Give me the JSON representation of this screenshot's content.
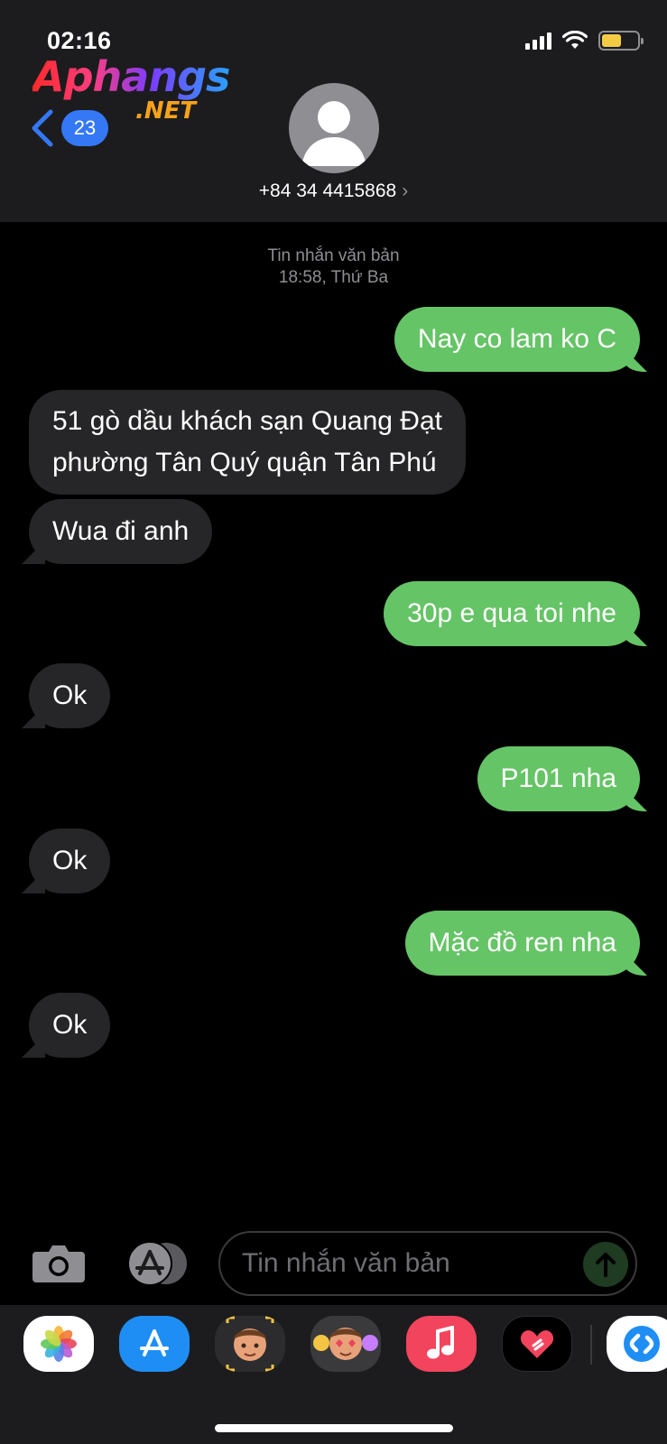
{
  "status_bar": {
    "time": "02:16",
    "battery_level": 0.55,
    "signal_bars": 4
  },
  "watermark": {
    "main": "Aphangs",
    "sub": ".NET"
  },
  "nav": {
    "back_count": "23"
  },
  "contact": {
    "phone": "+84 34 4415868",
    "chevron": "›",
    "avatar_icon": "person-silhouette-icon"
  },
  "thread_meta": {
    "type": "Tin nhắn văn bản",
    "timestamp": "18:58, Thứ Ba"
  },
  "messages": [
    {
      "direction": "outgoing",
      "text": "Nay co lam ko C"
    },
    {
      "direction": "incoming",
      "text": "51 gò dầu khách sạn Quang Đạt",
      "text2": "phường Tân Quý quận Tân Phú"
    },
    {
      "direction": "incoming",
      "text": "Wua đi anh"
    },
    {
      "direction": "outgoing",
      "text": "30p e qua toi nhe"
    },
    {
      "direction": "incoming",
      "text": "Ok"
    },
    {
      "direction": "outgoing",
      "text": "P101 nha"
    },
    {
      "direction": "incoming",
      "text": "Ok"
    },
    {
      "direction": "outgoing",
      "text": "Mặc đồ ren nha"
    },
    {
      "direction": "incoming",
      "text": "Ok"
    }
  ],
  "input": {
    "placeholder": "Tin nhắn văn bản"
  },
  "colors": {
    "outgoing_bubble": "#65c466",
    "incoming_bubble": "#262628",
    "badge": "#3478f6",
    "header": "#1c1c1e"
  },
  "app_drawer": [
    "photos-icon",
    "app-store-icon",
    "memoji-icon",
    "memoji-stickers-icon",
    "music-icon",
    "digital-touch-icon",
    "shazam-icon"
  ]
}
